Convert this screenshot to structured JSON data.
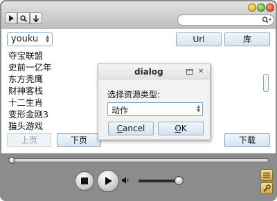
{
  "toolbar": {
    "search_placeholder": ""
  },
  "source_select": {
    "value": "youku"
  },
  "buttons": {
    "url": "Url",
    "library": "库",
    "prev_page": "上页",
    "next_page": "下页",
    "download": "下载"
  },
  "list_items": [
    "夺宝联盟",
    "史前一亿年",
    "东方秃鹰",
    "财神客栈",
    "十二生肖",
    "变形金刚3",
    "猫头游戏"
  ],
  "dialog": {
    "title": "dialog",
    "label": "选择资源类型:",
    "type_value": "动作",
    "cancel_rest": "ancel",
    "cancel_mnemonic": "C",
    "ok_rest": "K",
    "ok_mnemonic": "O"
  },
  "icons": {
    "play": "play-icon",
    "search": "search-icon",
    "down": "down-arrow-icon",
    "stop": "stop-icon",
    "volume": "volume-icon",
    "menu": "menu-icon",
    "tools": "wrench-icon"
  },
  "colors": {
    "frame": "#8c8c8c",
    "button_border": "#90a9bf",
    "accent_blue": "#7fa8c9"
  }
}
